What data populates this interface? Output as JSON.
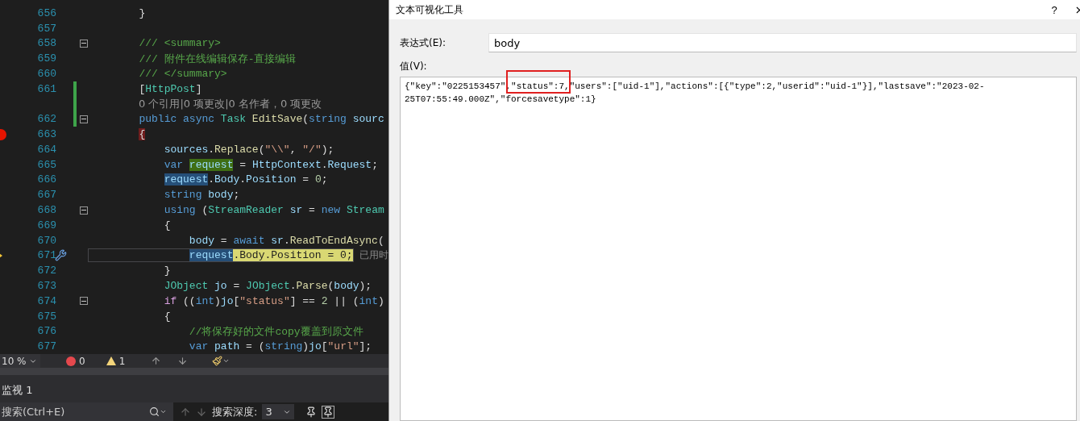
{
  "editor": {
    "lines": [
      {
        "kind": "code",
        "num": "656",
        "tokens": [
          {
            "text": "        }",
            "kind": "p"
          }
        ]
      },
      {
        "kind": "code",
        "num": "657"
      },
      {
        "kind": "code",
        "num": "658",
        "foldable": true,
        "tokens": [
          {
            "text": "        /// <summary>",
            "kind": "c"
          }
        ]
      },
      {
        "kind": "code",
        "num": "659",
        "tokens": [
          {
            "text": "        /// 附件在线编辑保存-直接编辑",
            "kind": "c"
          }
        ]
      },
      {
        "kind": "code",
        "num": "660",
        "tokens": [
          {
            "text": "        /// </summary>",
            "kind": "c"
          }
        ]
      },
      {
        "kind": "code",
        "num": "661",
        "changed": true,
        "tokens": [
          {
            "text": "        [",
            "kind": "p"
          },
          {
            "text": "HttpPost",
            "kind": "t"
          },
          {
            "text": "]",
            "kind": "p"
          }
        ]
      },
      {
        "kind": "codelens",
        "text": "0 个引用|0 项更改|0 名作者，0 项更改",
        "changed": true
      },
      {
        "kind": "code",
        "num": "662",
        "changed": true,
        "foldable": true,
        "tokens": [
          {
            "text": "        public async ",
            "kind": "k"
          },
          {
            "text": "Task ",
            "kind": "t"
          },
          {
            "text": "EditSave",
            "kind": "m"
          },
          {
            "text": "(",
            "kind": "p"
          },
          {
            "text": "string ",
            "kind": "k"
          },
          {
            "text": "sourc",
            "kind": "i"
          }
        ]
      },
      {
        "kind": "code",
        "num": "663",
        "breakpoint": true,
        "tokens": [
          {
            "text": "        {",
            "kind": "bb"
          }
        ]
      },
      {
        "kind": "code",
        "num": "664",
        "tokens": [
          {
            "text": "            sources",
            "kind": "i"
          },
          {
            "text": ".",
            "kind": "p"
          },
          {
            "text": "Replace",
            "kind": "m"
          },
          {
            "text": "(",
            "kind": "p"
          },
          {
            "text": "\"\\\\\"",
            "kind": "s"
          },
          {
            "text": ", ",
            "kind": "p"
          },
          {
            "text": "\"/\"",
            "kind": "s"
          },
          {
            "text": ");",
            "kind": "p"
          }
        ]
      },
      {
        "kind": "code",
        "num": "665",
        "tokens": [
          {
            "text": "            var ",
            "kind": "k"
          },
          {
            "text": "request",
            "kind": "hg"
          },
          {
            "text": " = ",
            "kind": "p"
          },
          {
            "text": "HttpContext",
            "kind": "i"
          },
          {
            "text": ".",
            "kind": "p"
          },
          {
            "text": "Request",
            "kind": "i"
          },
          {
            "text": ";",
            "kind": "p"
          }
        ]
      },
      {
        "kind": "code",
        "num": "666",
        "tokens": [
          {
            "text": "            request",
            "kind": "hb"
          },
          {
            "text": ".",
            "kind": "p"
          },
          {
            "text": "Body",
            "kind": "i"
          },
          {
            "text": ".",
            "kind": "p"
          },
          {
            "text": "Position",
            "kind": "i"
          },
          {
            "text": " = ",
            "kind": "p"
          },
          {
            "text": "0",
            "kind": "n"
          },
          {
            "text": ";",
            "kind": "p"
          }
        ]
      },
      {
        "kind": "code",
        "num": "667",
        "tokens": [
          {
            "text": "            string ",
            "kind": "k"
          },
          {
            "text": "body",
            "kind": "i"
          },
          {
            "text": ";",
            "kind": "p"
          }
        ]
      },
      {
        "kind": "code",
        "num": "668",
        "foldable": true,
        "tokens": [
          {
            "text": "            using ",
            "kind": "k"
          },
          {
            "text": "(",
            "kind": "p"
          },
          {
            "text": "StreamReader ",
            "kind": "t"
          },
          {
            "text": "sr",
            "kind": "i"
          },
          {
            "text": " = ",
            "kind": "p"
          },
          {
            "text": "new ",
            "kind": "k"
          },
          {
            "text": "Stream",
            "kind": "t"
          }
        ]
      },
      {
        "kind": "code",
        "num": "669",
        "tokens": [
          {
            "text": "            {",
            "kind": "p"
          }
        ]
      },
      {
        "kind": "code",
        "num": "670",
        "tokens": [
          {
            "text": "                body",
            "kind": "i"
          },
          {
            "text": " = ",
            "kind": "p"
          },
          {
            "text": "await ",
            "kind": "k"
          },
          {
            "text": "sr",
            "kind": "i"
          },
          {
            "text": ".",
            "kind": "p"
          },
          {
            "text": "ReadToEndAsync",
            "kind": "m"
          },
          {
            "text": "(",
            "kind": "p"
          }
        ]
      },
      {
        "kind": "code",
        "num": "671",
        "current": true,
        "hint": "已用时",
        "tokens": [
          {
            "text": "                request",
            "kind": "hb"
          },
          {
            "text": ".Body.Position = 0;",
            "kind": "hy"
          }
        ]
      },
      {
        "kind": "code",
        "num": "672",
        "tokens": [
          {
            "text": "            }",
            "kind": "p"
          }
        ]
      },
      {
        "kind": "code",
        "num": "673",
        "tokens": [
          {
            "text": "            JObject ",
            "kind": "t"
          },
          {
            "text": "jo",
            "kind": "i"
          },
          {
            "text": " = ",
            "kind": "p"
          },
          {
            "text": "JObject",
            "kind": "t"
          },
          {
            "text": ".",
            "kind": "p"
          },
          {
            "text": "Parse",
            "kind": "m"
          },
          {
            "text": "(",
            "kind": "p"
          },
          {
            "text": "body",
            "kind": "i"
          },
          {
            "text": ");",
            "kind": "p"
          }
        ]
      },
      {
        "kind": "code",
        "num": "674",
        "foldable": true,
        "tokens": [
          {
            "text": "            if ",
            "kind": "x"
          },
          {
            "text": "((",
            "kind": "p"
          },
          {
            "text": "int",
            "kind": "k"
          },
          {
            "text": ")",
            "kind": "p"
          },
          {
            "text": "jo",
            "kind": "i"
          },
          {
            "text": "[",
            "kind": "p"
          },
          {
            "text": "\"status\"",
            "kind": "s"
          },
          {
            "text": "] == ",
            "kind": "p"
          },
          {
            "text": "2",
            "kind": "n"
          },
          {
            "text": " || (",
            "kind": "p"
          },
          {
            "text": "int",
            "kind": "k"
          },
          {
            "text": ")",
            "kind": "p"
          }
        ]
      },
      {
        "kind": "code",
        "num": "675",
        "tokens": [
          {
            "text": "            {",
            "kind": "p"
          }
        ]
      },
      {
        "kind": "code",
        "num": "676",
        "tokens": [
          {
            "text": "                //将保存好的文件copy覆盖到原文件",
            "kind": "c"
          }
        ]
      },
      {
        "kind": "code",
        "num": "677",
        "tokens": [
          {
            "text": "                var ",
            "kind": "k"
          },
          {
            "text": "path",
            "kind": "i"
          },
          {
            "text": " = (",
            "kind": "p"
          },
          {
            "text": "string",
            "kind": "k"
          },
          {
            "text": ")",
            "kind": "p"
          },
          {
            "text": "jo",
            "kind": "i"
          },
          {
            "text": "[",
            "kind": "p"
          },
          {
            "text": "\"url\"",
            "kind": "s"
          },
          {
            "text": "];",
            "kind": "p"
          }
        ]
      }
    ]
  },
  "editor_toolbar": {
    "zoom": "10 %",
    "errors": "0",
    "warnings": "1"
  },
  "watch_panel": {
    "title": "监视 1",
    "search": {
      "placeholder": "搜索(Ctrl+E)"
    },
    "depth_label": "搜索深度:",
    "depth": "3"
  },
  "dialog": {
    "title": "文本可视化工具",
    "help": "?",
    "expression_label": "表达式(E):",
    "expression": "body",
    "value_label": "值(V):",
    "value_lines": [
      [
        {
          "text": "{\"key\":\"0225153457\","
        },
        {
          "text": "\"status\":7",
          "marked": true
        },
        {
          "text": ",\"users\":[\"uid-1\"],\"actions\":[{\"type\":2,\"userid\":\"uid-1\"}],\"lastsave\":\"2023-02-"
        }
      ],
      [
        {
          "text": "25T07:55:49.000Z\",\"forcesavetype\":1}"
        }
      ]
    ]
  }
}
